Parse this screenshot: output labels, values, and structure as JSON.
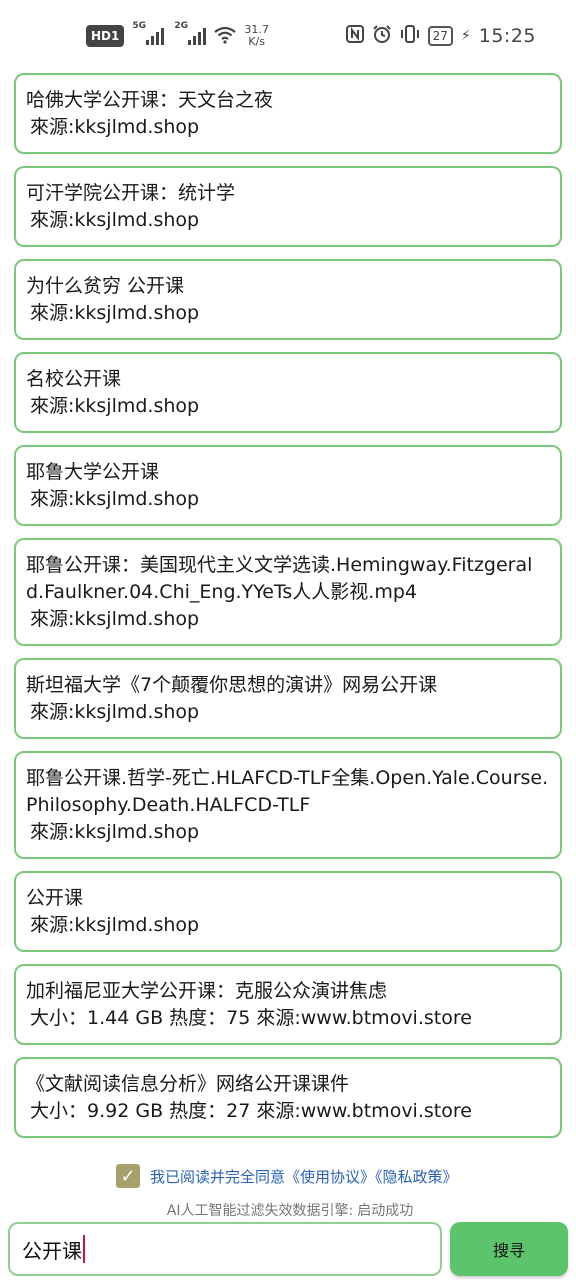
{
  "status_bar": {
    "hd_label": "HD",
    "hd_index": "1",
    "net1": "5G",
    "net2": "2G",
    "speed_value": "31.7",
    "speed_unit": "K/s",
    "battery": "27",
    "time": "15:25",
    "icons": [
      "nfc-icon",
      "alarm-icon",
      "vibrate-icon",
      "battery-icon",
      "charging-icon"
    ]
  },
  "results": [
    {
      "title": "哈佛大学公开课：天文台之夜",
      "source": "來源:kksjlmd.shop"
    },
    {
      "title": "可汗学院公开课：统计学",
      "source": "來源:kksjlmd.shop"
    },
    {
      "title": "为什么贫穷 公开课",
      "source": "來源:kksjlmd.shop"
    },
    {
      "title": "名校公开课",
      "source": "來源:kksjlmd.shop"
    },
    {
      "title": "耶鲁大学公开课",
      "source": "來源:kksjlmd.shop"
    },
    {
      "title": "耶鲁公开课：美国现代主义文学选读.Hemingway.Fitzgerald.Faulkner.04.Chi_Eng.YYeTs人人影视.mp4",
      "source": "來源:kksjlmd.shop"
    },
    {
      "title": "斯坦福大学《7个颠覆你思想的演讲》网易公开课",
      "source": "來源:kksjlmd.shop"
    },
    {
      "title": "耶鲁公开课.哲学-死亡.HLAFCD-TLF全集.Open.Yale.Course.Philosophy.Death.HALFCD-TLF",
      "source": "來源:kksjlmd.shop"
    },
    {
      "title": "公开课",
      "source": "來源:kksjlmd.shop"
    },
    {
      "title": "加利福尼亚大学公开课：克服公众演讲焦虑",
      "source": "大小：1.44 GB  热度：75   來源:www.btmovi.store"
    },
    {
      "title": "《文献阅读信息分析》网络公开课课件",
      "source": "大小：9.92 GB  热度：27   來源:www.btmovi.store"
    }
  ],
  "agreement": {
    "checked": true,
    "text": "我已阅读并完全同意《使用协议》《隐私政策》"
  },
  "engine_status": {
    "label": "AI人工智能过滤失效数据引擎:",
    "value": "启动成功"
  },
  "search": {
    "value": "公开课",
    "button_label": "搜寻"
  },
  "colors": {
    "card_border": "#7ac87a",
    "button": "#5cc46a",
    "link": "#2a62b8",
    "checkbox": "#a7a06a"
  }
}
